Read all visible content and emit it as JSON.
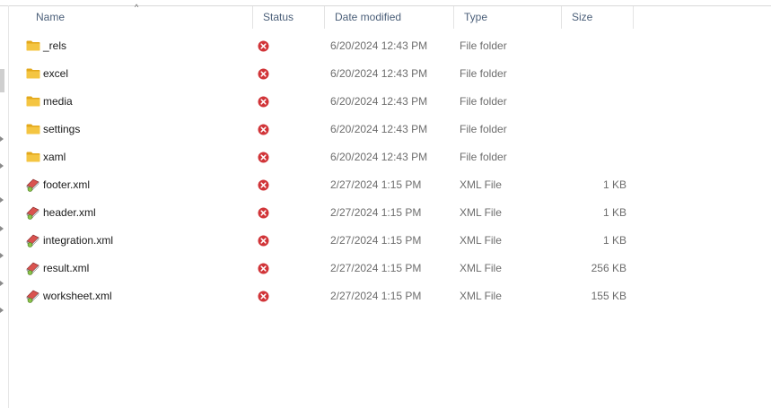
{
  "columns": {
    "name": "Name",
    "status": "Status",
    "date_modified": "Date modified",
    "type": "Type",
    "size": "Size"
  },
  "sort_indicator": "^",
  "status_color": "#d13438",
  "folder_color": "#f4c542",
  "files": [
    {
      "name": "_rels",
      "status": "error",
      "date": "6/20/2024 12:43 PM",
      "type": "File folder",
      "size": "",
      "icon": "folder-icon"
    },
    {
      "name": "excel",
      "status": "error",
      "date": "6/20/2024 12:43 PM",
      "type": "File folder",
      "size": "",
      "icon": "folder-icon"
    },
    {
      "name": "media",
      "status": "error",
      "date": "6/20/2024 12:43 PM",
      "type": "File folder",
      "size": "",
      "icon": "folder-icon"
    },
    {
      "name": "settings",
      "status": "error",
      "date": "6/20/2024 12:43 PM",
      "type": "File folder",
      "size": "",
      "icon": "folder-icon"
    },
    {
      "name": "xaml",
      "status": "error",
      "date": "6/20/2024 12:43 PM",
      "type": "File folder",
      "size": "",
      "icon": "folder-icon"
    },
    {
      "name": "footer.xml",
      "status": "error",
      "date": "2/27/2024 1:15 PM",
      "type": "XML File",
      "size": "1 KB",
      "icon": "xml-file-icon"
    },
    {
      "name": "header.xml",
      "status": "error",
      "date": "2/27/2024 1:15 PM",
      "type": "XML File",
      "size": "1 KB",
      "icon": "xml-file-icon"
    },
    {
      "name": "integration.xml",
      "status": "error",
      "date": "2/27/2024 1:15 PM",
      "type": "XML File",
      "size": "1 KB",
      "icon": "xml-file-icon"
    },
    {
      "name": "result.xml",
      "status": "error",
      "date": "2/27/2024 1:15 PM",
      "type": "XML File",
      "size": "256 KB",
      "icon": "xml-file-icon"
    },
    {
      "name": "worksheet.xml",
      "status": "error",
      "date": "2/27/2024 1:15 PM",
      "type": "XML File",
      "size": "155 KB",
      "icon": "xml-file-icon"
    }
  ]
}
